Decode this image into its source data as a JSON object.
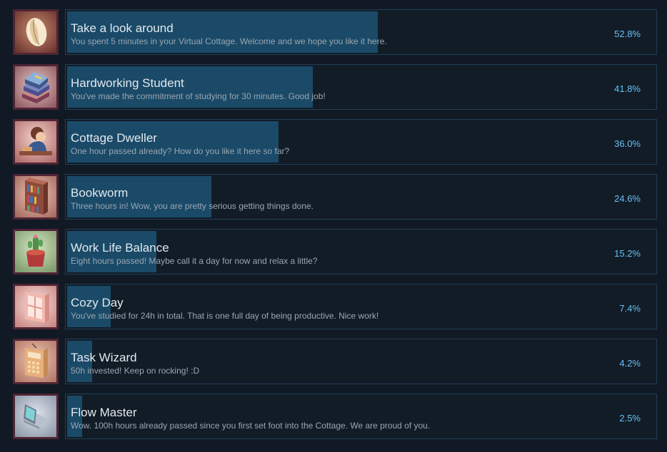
{
  "colors": {
    "background": "#111a24",
    "progress_fill": "#1a4a68",
    "bar_border": "#213e56",
    "icon_border": "#4f2434",
    "percent_text": "#66c0f4"
  },
  "achievements": [
    {
      "title": "Take a look around",
      "description": "You spent 5 minutes in your Virtual Cottage. Welcome and we hope you like it here.",
      "percent_label": "52.8%",
      "percent": 52.8,
      "icon": "coffee-bean-icon"
    },
    {
      "title": "Hardworking Student",
      "description": "You've made the commitment of studying for 30 minutes. Good job!",
      "percent_label": "41.8%",
      "percent": 41.8,
      "icon": "book-stack-icon"
    },
    {
      "title": "Cottage Dweller",
      "description": "One hour passed already? How do you like it here so far?",
      "percent_label": "36.0%",
      "percent": 36.0,
      "icon": "person-at-desk-icon"
    },
    {
      "title": "Bookworm",
      "description": "Three hours in! Wow, you are pretty serious getting things done.",
      "percent_label": "24.6%",
      "percent": 24.6,
      "icon": "bookshelf-icon"
    },
    {
      "title": "Work Life Balance",
      "description": "Eight hours passed! Maybe call it a day for now and relax a little?",
      "percent_label": "15.2%",
      "percent": 15.2,
      "icon": "potted-cactus-icon"
    },
    {
      "title": "Cozy Day",
      "description": "You've studied for 24h in total. That is one full day of being productive. Nice work!",
      "percent_label": "7.4%",
      "percent": 7.4,
      "icon": "window-icon"
    },
    {
      "title": "Task Wizard",
      "description": "50h invested! Keep on rocking! :D",
      "percent_label": "4.2%",
      "percent": 4.2,
      "icon": "calculator-icon"
    },
    {
      "title": "Flow Master",
      "description": "Wow. 100h hours already passed since you first set foot into the Cottage. We are proud of you.",
      "percent_label": "2.5%",
      "percent": 2.5,
      "icon": "laptop-icon"
    }
  ]
}
